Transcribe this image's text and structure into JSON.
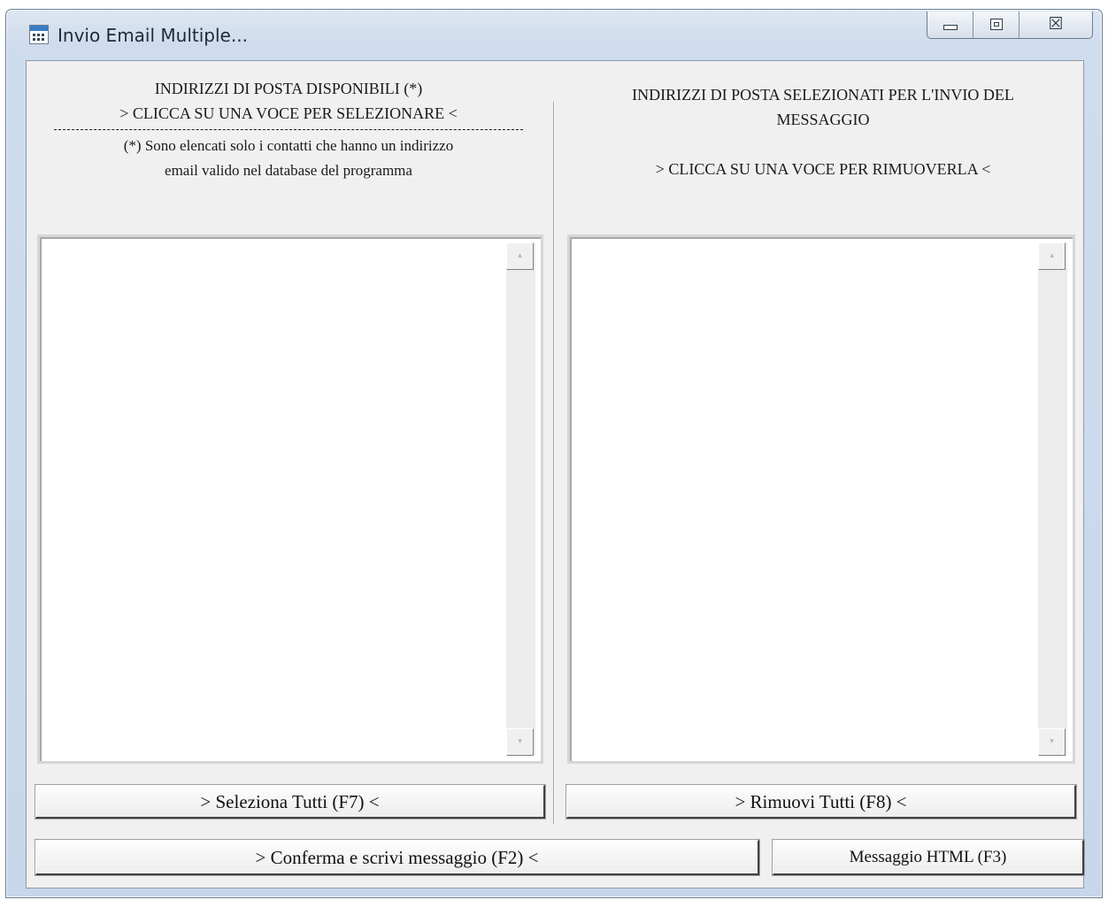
{
  "window": {
    "title": "Invio Email Multiple...",
    "icon": "app-window-icon",
    "controls": {
      "minimize_icon": "minimize-icon",
      "maximize_icon": "maximize-icon",
      "close_glyph": "☒"
    }
  },
  "left_panel": {
    "heading_line1": "INDIRIZZI DI POSTA DISPONIBILI (*)",
    "heading_line2": "> CLICCA SU UNA VOCE PER SELEZIONARE <",
    "note_line1": "(*) Sono elencati solo i contatti che hanno un indirizzo",
    "note_line2": "email valido nel database del programma",
    "items": []
  },
  "right_panel": {
    "heading_line1": "INDIRIZZI DI POSTA SELEZIONATI PER L'INVIO DEL",
    "heading_line2": "MESSAGGIO",
    "heading_line3": "> CLICCA SU UNA VOCE PER RIMUOVERLA <",
    "items": []
  },
  "scrollbar": {
    "up_arrow": "▴",
    "down_arrow": "▾"
  },
  "buttons": {
    "select_all": "> Seleziona Tutti  (F7) <",
    "remove_all": "> Rimuovi Tutti (F8) <",
    "confirm": "> Conferma e scrivi messaggio  (F2) <",
    "html_message": "Messaggio HTML  (F3)"
  }
}
